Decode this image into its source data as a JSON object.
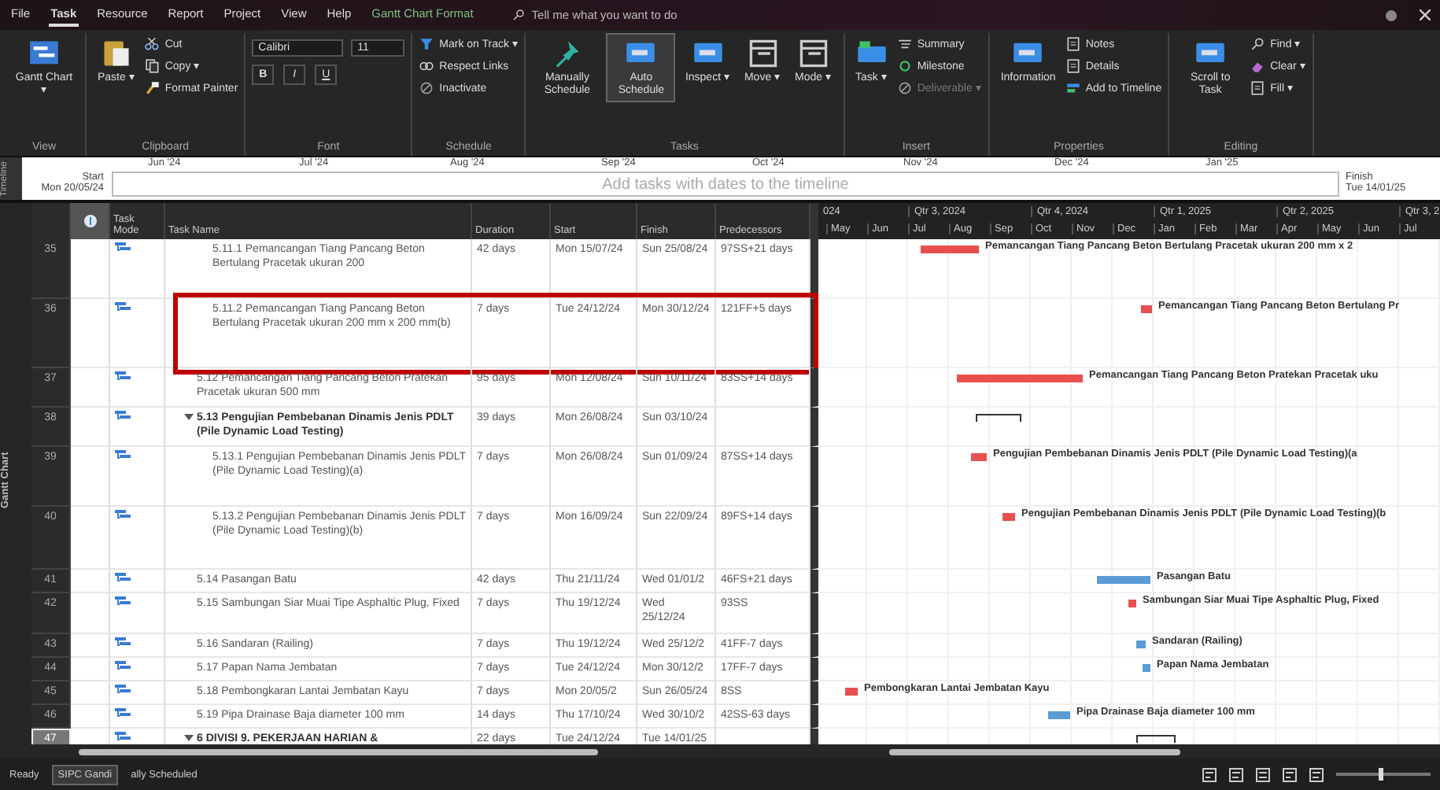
{
  "menu_tabs": [
    {
      "label": "File",
      "selected": false
    },
    {
      "label": "Task",
      "selected": true
    },
    {
      "label": "Resource",
      "selected": false
    },
    {
      "label": "Report",
      "selected": false
    },
    {
      "label": "Project",
      "selected": false
    },
    {
      "label": "View",
      "selected": false
    },
    {
      "label": "Help",
      "selected": false
    },
    {
      "label": "Gantt Chart Format",
      "selected": false,
      "kind": "contextual"
    }
  ],
  "search": {
    "placeholder": "Tell me what you want to do"
  },
  "ribbon": {
    "groups": [
      {
        "label": "View",
        "items": [
          {
            "kind": "large",
            "label": "Gantt Chart ▾"
          }
        ]
      },
      {
        "label": "Clipboard",
        "items": [
          {
            "kind": "large",
            "label": "Paste ▾"
          },
          {
            "kind": "small",
            "label": "Cut"
          },
          {
            "kind": "small",
            "label": "Copy ▾"
          },
          {
            "kind": "small",
            "label": "Format Painter"
          }
        ]
      },
      {
        "label": "Font",
        "items": [
          {
            "kind": "field",
            "value": "Calibri"
          },
          {
            "kind": "field",
            "value": "11"
          },
          {
            "kind": "glyph",
            "label": "B"
          },
          {
            "kind": "glyph",
            "label": "I"
          },
          {
            "kind": "glyph",
            "label": "U"
          }
        ]
      },
      {
        "label": "Schedule",
        "items": [
          {
            "kind": "small",
            "label": "Mark on Track ▾"
          },
          {
            "kind": "small",
            "label": "Respect Links"
          },
          {
            "kind": "small",
            "label": "Inactivate"
          }
        ]
      },
      {
        "label": "Tasks",
        "items": [
          {
            "kind": "large",
            "label": "Manually Schedule",
            "selected": false
          },
          {
            "kind": "large",
            "label": "Auto Schedule",
            "selected": true
          },
          {
            "kind": "large",
            "label": "Inspect ▾"
          },
          {
            "kind": "large",
            "label": "Move ▾"
          },
          {
            "kind": "large",
            "label": "Mode ▾"
          }
        ]
      },
      {
        "label": "Insert",
        "items": [
          {
            "kind": "large",
            "label": "Task ▾"
          },
          {
            "kind": "small",
            "label": "Summary",
            "disabled": false
          },
          {
            "kind": "small",
            "label": "Milestone",
            "disabled": false
          },
          {
            "kind": "small",
            "label": "Deliverable ▾",
            "disabled": true
          }
        ]
      },
      {
        "label": "Properties",
        "items": [
          {
            "kind": "large",
            "label": "Information"
          },
          {
            "kind": "small",
            "label": "Notes"
          },
          {
            "kind": "small",
            "label": "Details"
          },
          {
            "kind": "small",
            "label": "Add to Timeline"
          }
        ]
      },
      {
        "label": "Editing",
        "items": [
          {
            "kind": "large",
            "label": "Scroll to Task"
          },
          {
            "kind": "small",
            "label": "Find ▾"
          },
          {
            "kind": "small",
            "label": "Clear ▾"
          },
          {
            "kind": "small",
            "label": "Fill ▾"
          }
        ]
      }
    ]
  },
  "timeline": {
    "side_label": "Timeline",
    "start_label": "Start",
    "start_date": "Mon 20/05/24",
    "finish_label": "Finish",
    "finish_date": "Tue 14/01/25",
    "placeholder": "Add tasks with dates to the timeline",
    "ticks": [
      "Jun '24",
      "Jul '24",
      "Aug '24",
      "Sep '24",
      "Oct '24",
      "Nov '24",
      "Dec '24",
      "Jan '25"
    ]
  },
  "sheet": {
    "side_label": "Gantt Chart",
    "columns": [
      "Task Mode",
      "Task Name",
      "Duration",
      "Start",
      "Finish",
      "Predecessors"
    ]
  },
  "gantt_header": {
    "quarters": [
      "024",
      "Qtr 3, 2024",
      "Qtr 4, 2024",
      "Qtr 1, 2025",
      "Qtr 2, 2025",
      "Qtr 3, 2"
    ],
    "months": [
      "May",
      "Jun",
      "Jul",
      "Aug",
      "Sep",
      "Oct",
      "Nov",
      "Dec",
      "Jan",
      "Feb",
      "Mar",
      "Apr",
      "May",
      "Jun",
      "Jul"
    ]
  },
  "rows": [
    {
      "id": "35",
      "kind": "subtask",
      "name": "5.11.1 Pemancangan Tiang Pancang Beton Bertulang Pracetak ukuran 200",
      "duration": "42 days",
      "start": "Mon 15/07/24",
      "finish": "Sun 25/08/24",
      "predecessors": "97SS+21 days",
      "critical": true,
      "selected": false,
      "bar_label": "Pemancangan Tiang Pancang Beton Bertulang Pracetak ukuran 200 mm x 2"
    },
    {
      "id": "36",
      "kind": "subtask",
      "name": "5.11.2 Pemancangan Tiang Pancang Beton Bertulang Pracetak ukuran 200 mm x 200 mm(b)",
      "duration": "7 days",
      "start": "Tue 24/12/24",
      "finish": "Mon 30/12/24",
      "predecessors": "121FF+5 days",
      "critical": true,
      "selected": false,
      "highlighted": true,
      "bar_label": "Pemancangan Tiang Pancang Beton Bertulang Pr"
    },
    {
      "id": "37",
      "kind": "task",
      "name": "5.12 Pemancangan Tiang Pancang Beton Pratekan Pracetak ukuran 500 mm",
      "duration": "95 days",
      "start": "Mon 12/08/24",
      "finish": "Sun 10/11/24",
      "predecessors": "83SS+14 days",
      "critical": true,
      "selected": false,
      "bar_label": "Pemancangan Tiang Pancang Beton Pratekan Pracetak uku"
    },
    {
      "id": "38",
      "kind": "summary",
      "name": "5.13 Pengujian Pembebanan Dinamis Jenis PDLT (Pile Dynamic Load Testing)",
      "duration": "39 days",
      "start": "Mon 26/08/24",
      "finish": "Sun 03/10/24",
      "selected": false,
      "expanded": true,
      "children": [
        {
          "id": "39",
          "kind": "task",
          "name": "5.13.1 Pengujian Pembebanan Dinamis Jenis PDLT (Pile Dynamic Load Testing)(a)",
          "duration": "7 days",
          "start": "Mon 26/08/24",
          "finish": "Sun 01/09/24",
          "predecessors": "87SS+14 days",
          "critical": true,
          "selected": false,
          "bar_label": "Pengujian Pembebanan Dinamis Jenis PDLT (Pile Dynamic Load Testing)(a"
        },
        {
          "id": "40",
          "kind": "task",
          "name": "5.13.2 Pengujian Pembebanan Dinamis Jenis PDLT (Pile Dynamic Load Testing)(b)",
          "duration": "7 days",
          "start": "Mon 16/09/24",
          "finish": "Sun 22/09/24",
          "predecessors": "89FS+14 days",
          "critical": true,
          "selected": false,
          "bar_label": "Pengujian Pembebanan Dinamis Jenis PDLT (Pile Dynamic Load Testing)(b"
        }
      ]
    },
    {
      "id": "41",
      "kind": "task",
      "name": "5.14 Pasangan Batu",
      "duration": "42 days",
      "start": "Thu 21/11/24",
      "finish": "Wed 01/01/2",
      "predecessors": "46FS+21 days",
      "critical": false,
      "selected": false,
      "bar_label": "Pasangan Batu"
    },
    {
      "id": "42",
      "kind": "task",
      "name": "5.15 Sambungan Siar Muai Tipe Asphaltic Plug, Fixed",
      "duration": "7 days",
      "start": "Thu 19/12/24",
      "finish": "Wed 25/12/24",
      "predecessors": "93SS",
      "critical": true,
      "selected": false,
      "bar_label": "Sambungan Siar Muai Tipe Asphaltic Plug, Fixed"
    },
    {
      "id": "43",
      "kind": "task",
      "name": "5.16 Sandaran (Railing)",
      "duration": "7 days",
      "start": "Thu 19/12/24",
      "finish": "Wed 25/12/2",
      "predecessors": "41FF-7 days",
      "critical": false,
      "selected": false,
      "bar_label": "Sandaran (Railing)"
    },
    {
      "id": "44",
      "kind": "task",
      "name": "5.17 Papan Nama Jembatan",
      "duration": "7 days",
      "start": "Tue 24/12/24",
      "finish": "Mon 30/12/2",
      "predecessors": "17FF-7 days",
      "critical": false,
      "selected": false,
      "bar_label": "Papan Nama Jembatan"
    },
    {
      "id": "45",
      "kind": "task",
      "name": "5.18 Pembongkaran Lantai Jembatan Kayu",
      "duration": "7 days",
      "start": "Mon 20/05/2",
      "finish": "Sun 26/05/24",
      "predecessors": "8SS",
      "critical": true,
      "selected": false,
      "bar_label": "Pembongkaran Lantai Jembatan Kayu"
    },
    {
      "id": "46",
      "kind": "task",
      "name": "5.19 Pipa Drainase Baja diameter 100 mm",
      "duration": "14 days",
      "start": "Thu 17/10/24",
      "finish": "Wed 30/10/2",
      "predecessors": "42SS-63 days",
      "critical": false,
      "selected": false,
      "bar_label": "Pipa Drainase Baja diameter 100 mm"
    },
    {
      "id": "47",
      "kind": "summary",
      "name": "6 DIVISI 9. PEKERJAAN HARIAN &",
      "duration": "22 days",
      "start": "Tue 24/12/24",
      "finish": "Tue 14/01/25",
      "selected": true,
      "expanded": true
    }
  ],
  "status_bar": {
    "ready": "Ready",
    "tooltip": "SIPC Gandi",
    "mode": "ally Scheduled",
    "zoom": {
      "level": 0.45
    }
  }
}
